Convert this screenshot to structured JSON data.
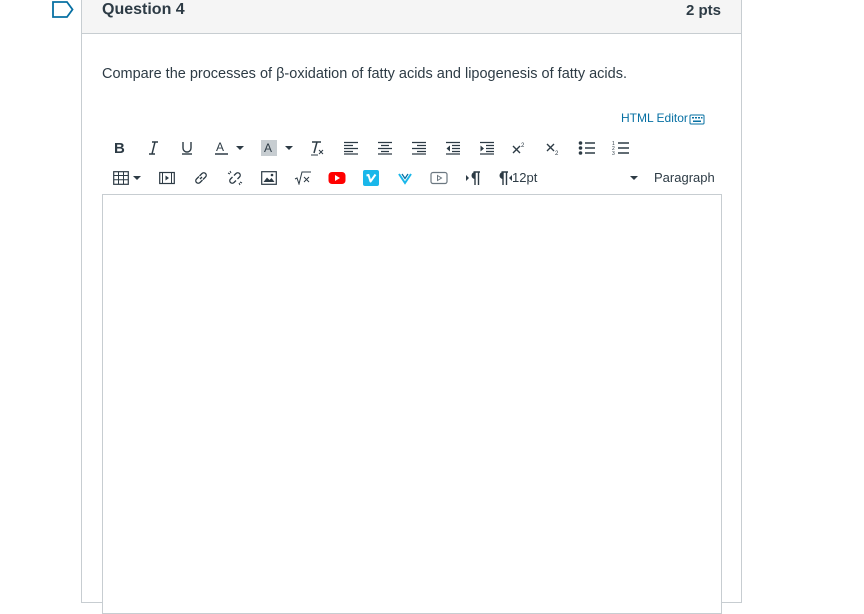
{
  "question": {
    "title": "Question 4",
    "points": "2 pts",
    "text": "Compare the processes of β-oxidation of fatty acids and lipogenesis of fatty acids."
  },
  "editor": {
    "html_editor_label": "HTML Editor",
    "font_size": "12pt",
    "block_format": "Paragraph",
    "content": ""
  },
  "toolbar_row1": [
    "bold-icon",
    "italic-icon",
    "underline-icon",
    "text-color-icon",
    "background-color-icon",
    "clear-formatting-icon",
    "align-left-icon",
    "align-center-icon",
    "align-right-icon",
    "outdent-icon",
    "indent-icon",
    "superscript-icon",
    "subscript-icon",
    "bullet-list-icon",
    "numbered-list-icon"
  ],
  "toolbar_row2": [
    "table-icon",
    "media-icon",
    "link-icon",
    "unlink-icon",
    "image-icon",
    "math-equation-icon",
    "youtube-icon",
    "vimeo-icon",
    "v-icon",
    "video-icon",
    "ltr-icon",
    "rtl-icon"
  ],
  "colors": {
    "accent": "#0770a3",
    "border": "#c7cdd1",
    "header_bg": "#f5f5f5",
    "text": "#2d3b45",
    "youtube": "#ff0000",
    "vimeo": "#1ab7ea"
  }
}
